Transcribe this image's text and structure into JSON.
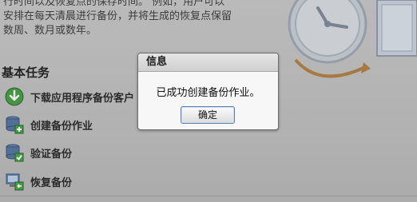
{
  "intro": {
    "line1": "行时间以及恢复点的保存时间。 例如，用户可以",
    "line2": "安排在每天清晨进行备份，并将生成的恢复点保留",
    "line3": "数周、数月或数年。"
  },
  "section_title": "基本任务",
  "tasks": [
    {
      "label": "下载应用程序备份客户",
      "icon": "download-icon"
    },
    {
      "label": "创建备份作业",
      "icon": "database-add-icon"
    },
    {
      "label": "验证备份",
      "icon": "database-check-icon"
    },
    {
      "label": "恢复备份",
      "icon": "restore-icon"
    }
  ],
  "dialog": {
    "title": "信息",
    "message": "已成功创建备份作业。",
    "ok_label": "确定"
  }
}
